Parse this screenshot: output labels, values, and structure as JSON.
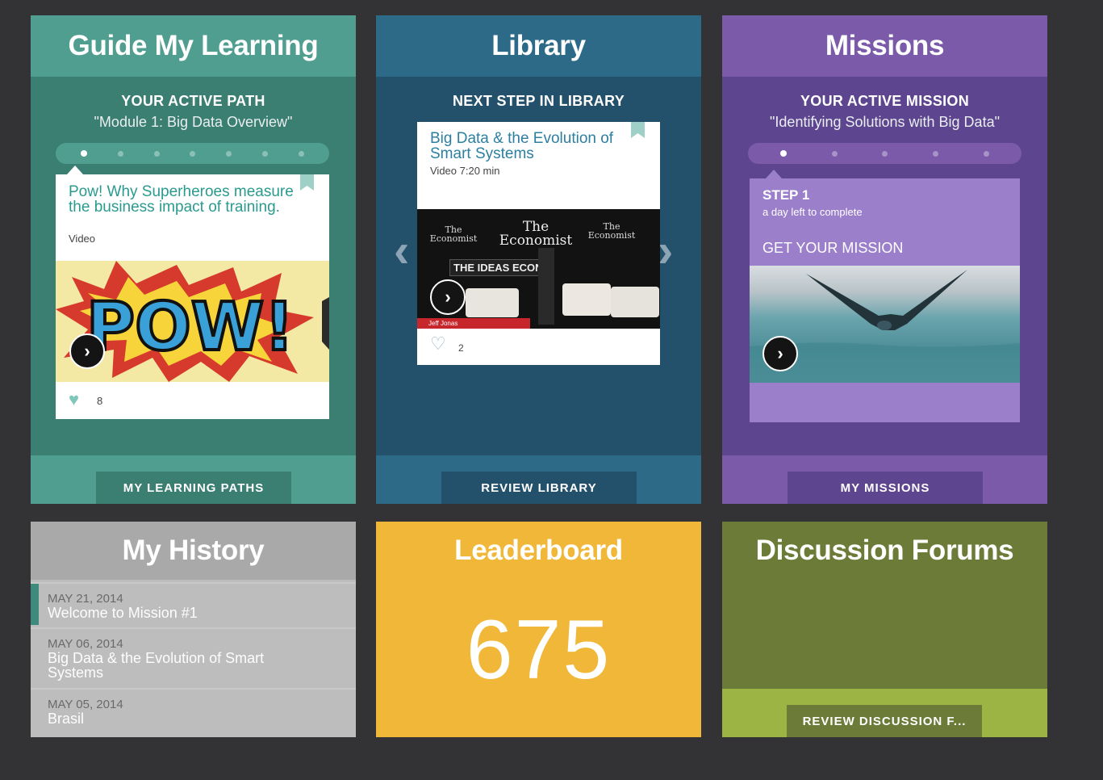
{
  "guide": {
    "title": "Guide My Learning",
    "section_head": "YOUR ACTIVE PATH",
    "path_name": "\"Module 1: Big Data Overview\"",
    "card": {
      "title": "Pow! Why Superheroes measure the business impact of training.",
      "type": "Video",
      "image_text": "POW!",
      "likes": "8"
    },
    "footer_button": "MY LEARNING PATHS",
    "progress": {
      "total_steps": 7,
      "current_step": 1
    }
  },
  "library": {
    "title": "Library",
    "section_head": "NEXT STEP IN LIBRARY",
    "card": {
      "title": "Big Data & the Evolution of Smart Systems",
      "meta": "Video 7:20 min",
      "banner_left": "The Economist",
      "banner_main": "The Economist",
      "banner_right": "The Economist",
      "stage_sign": "THE IDEAS ECON",
      "lower_third": "Jeff Jonas",
      "likes": "2"
    },
    "footer_button": "REVIEW LIBRARY"
  },
  "missions": {
    "title": "Missions",
    "section_head": "YOUR ACTIVE MISSION",
    "mission_name": "\"Identifying Solutions with Big Data\"",
    "card": {
      "step": "STEP 1",
      "due": "a day left to complete",
      "cta": "GET YOUR MISSION"
    },
    "footer_button": "MY MISSIONS",
    "progress": {
      "total_steps": 5,
      "current_step": 1
    }
  },
  "history": {
    "title": "My History",
    "items": [
      {
        "date": "MAY 21, 2014",
        "text": "Welcome to Mission #1"
      },
      {
        "date": "MAY 06, 2014",
        "text": "Big Data & the Evolution of Smart Systems"
      },
      {
        "date": "MAY 05, 2014",
        "text": "Brasil"
      }
    ]
  },
  "leaderboard": {
    "title": "Leaderboard",
    "score": "675"
  },
  "forums": {
    "title": "Discussion Forums",
    "footer_button": "REVIEW DISCUSSION F..."
  },
  "colors": {
    "guide": "#4f9e8f",
    "library": "#2d6a88",
    "missions": "#7a5aa9",
    "history": "#bdbdbd",
    "leaderboard": "#f0b739",
    "forums": "#6c7c38"
  },
  "icons": [
    "play-icon",
    "heart-icon",
    "bookmark-icon",
    "chevron-left-icon",
    "chevron-right-icon"
  ]
}
